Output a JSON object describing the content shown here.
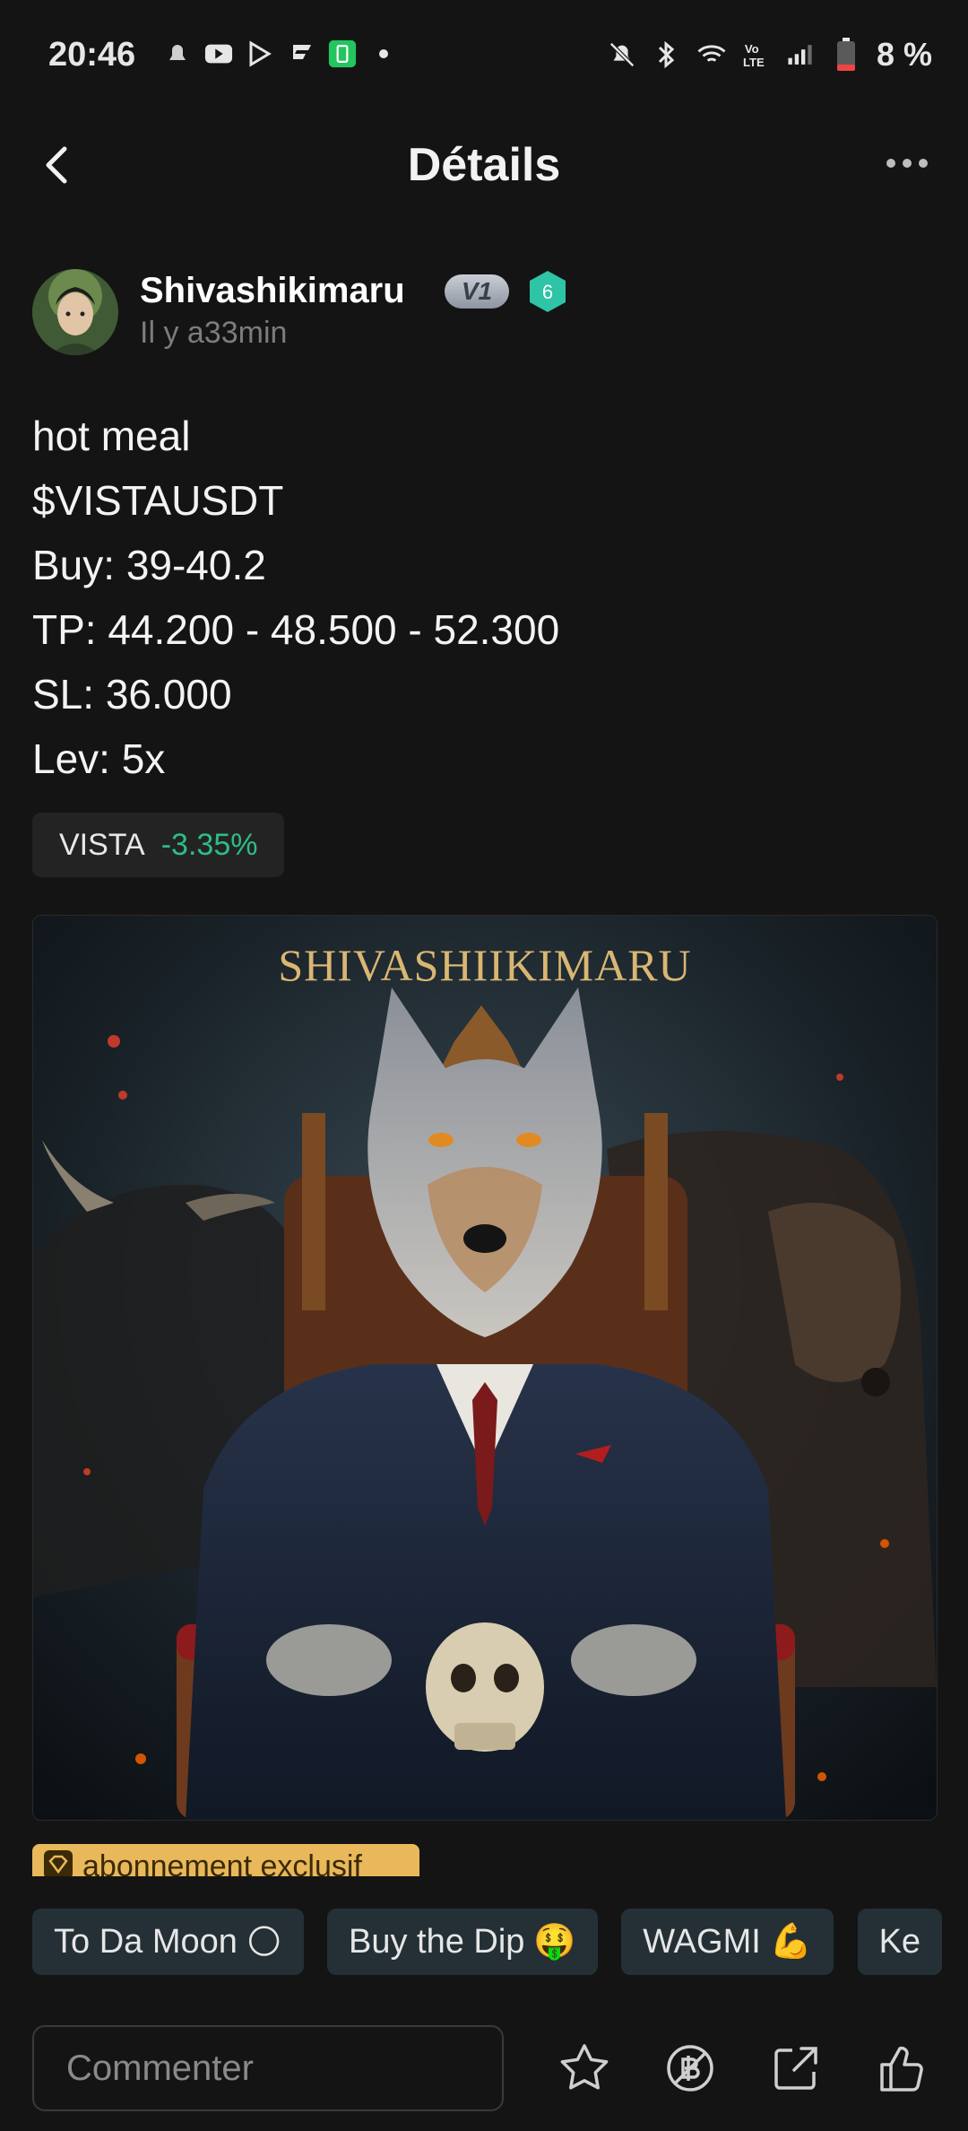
{
  "status_bar": {
    "time": "20:46",
    "battery_text": "8 %",
    "left_icons": [
      "notification-icon",
      "youtube-icon",
      "play-store-icon",
      "app-icon",
      "green-app-icon",
      "dot-icon"
    ],
    "right_icons": [
      "mute-icon",
      "bluetooth-icon",
      "wifi-icon",
      "volte-icon",
      "signal-icon",
      "battery-icon"
    ]
  },
  "header": {
    "title": "Détails"
  },
  "author": {
    "name": "Shivashikimaru",
    "badge": "V1",
    "level": "6",
    "time_ago": "Il y a33min"
  },
  "post": {
    "lines": [
      "hot meal",
      "$VISTAUSDT",
      "Buy: 39-40.2",
      "TP: 44.200 - 48.500 - 52.300",
      "SL: 36.000",
      "Lev: 5x"
    ]
  },
  "ticker": {
    "symbol": "VISTA",
    "change": "-3.35%"
  },
  "image": {
    "caption": "SHIVASHIIKIMARU"
  },
  "exclusive": {
    "label": "abonnement exclusif"
  },
  "chips": [
    {
      "label": "To Da Moon",
      "emoji": "🌕"
    },
    {
      "label": "Buy the Dip",
      "emoji": "🤑"
    },
    {
      "label": "WAGMI",
      "emoji": "💪"
    },
    {
      "label": "Ke",
      "emoji": ""
    }
  ],
  "bottom_bar": {
    "comment_placeholder": "Commenter"
  },
  "colors": {
    "background": "#141414",
    "positive": "#2ebd85",
    "accent_teal": "#2ec4a5",
    "exclusive": "#e8b85a"
  }
}
